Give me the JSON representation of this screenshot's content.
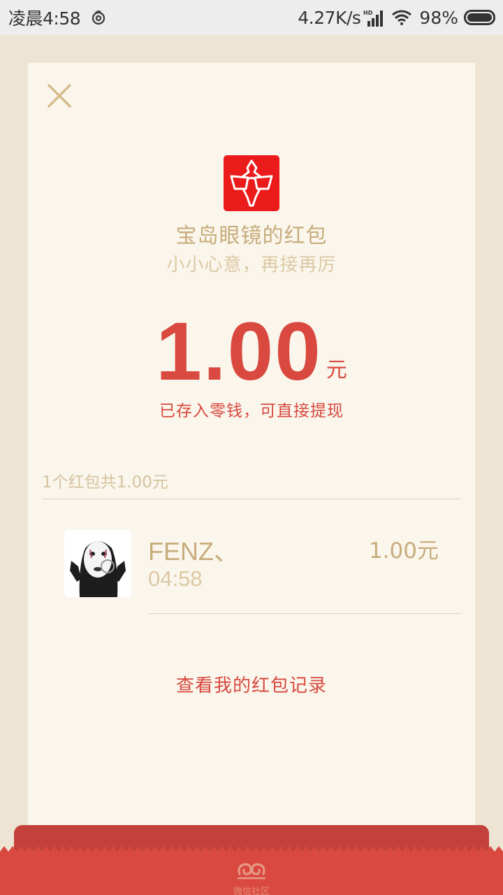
{
  "status_bar": {
    "time": "凌晨4:58",
    "net_speed": "4.27K/s",
    "battery": "98%",
    "icons": [
      "netease-music-icon",
      "hd-signal-icon",
      "wifi-icon",
      "battery-icon"
    ]
  },
  "packet": {
    "sender": "宝岛眼镜的红包",
    "greeting": "小小心意，再接再厉",
    "amount": "1.00",
    "unit": "元",
    "note": "已存入零钱，可直接提现"
  },
  "summary": "1个红包共1.00元",
  "records": [
    {
      "name": "FENZ、",
      "time": "04:58",
      "amount": "1.00元"
    }
  ],
  "history_link": "查看我的红包记录",
  "footer": {
    "text": "微信社区"
  },
  "colors": {
    "accent_red": "#d9493f",
    "gold": "#c8ac7c",
    "card_bg": "#faf6ec",
    "page_bg": "#ede4d3",
    "logo_red": "#ec1b1b"
  }
}
